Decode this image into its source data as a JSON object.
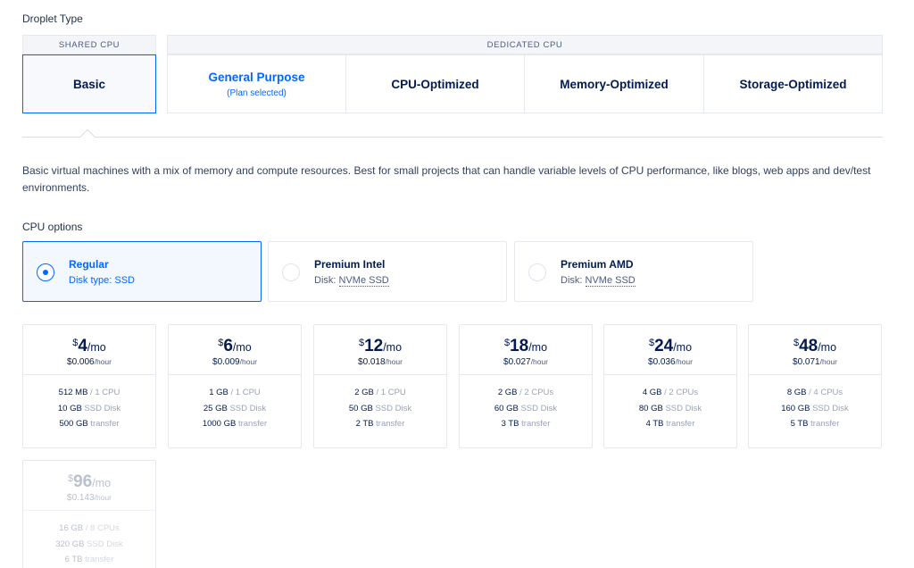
{
  "droplet_type": {
    "title": "Droplet Type",
    "shared_label": "SHARED CPU",
    "dedicated_label": "DEDICATED CPU",
    "plans": {
      "basic": "Basic",
      "general_purpose": "General Purpose",
      "general_purpose_sub": "(Plan selected)",
      "cpu_optimized": "CPU-Optimized",
      "memory_optimized": "Memory-Optimized",
      "storage_optimized": "Storage-Optimized"
    },
    "description": "Basic virtual machines with a mix of memory and compute resources. Best for small projects that can handle variable levels of CPU performance, like blogs, web apps and dev/test environments."
  },
  "cpu_options": {
    "title": "CPU options",
    "regular": {
      "label": "Regular",
      "disk_prefix": "Disk type: ",
      "disk": "SSD"
    },
    "intel": {
      "label": "Premium Intel",
      "disk_prefix": "Disk: ",
      "disk": "NVMe SSD"
    },
    "amd": {
      "label": "Premium AMD",
      "disk_prefix": "Disk: ",
      "disk": "NVMe SSD"
    }
  },
  "pricing": {
    "currency": "$",
    "per_month": "/mo",
    "per_hour": "/hour",
    "cards": [
      {
        "price": "4",
        "hourly": "$0.006",
        "mem": "512 MB",
        "cpu": " / 1 CPU",
        "disk": "10 GB",
        "disk_unit": " SSD Disk",
        "transfer": "500 GB",
        "transfer_unit": " transfer"
      },
      {
        "price": "6",
        "hourly": "$0.009",
        "mem": "1 GB",
        "cpu": " / 1 CPU",
        "disk": "25 GB",
        "disk_unit": " SSD Disk",
        "transfer": "1000 GB",
        "transfer_unit": " transfer"
      },
      {
        "price": "12",
        "hourly": "$0.018",
        "mem": "2 GB",
        "cpu": " / 1 CPU",
        "disk": "50 GB",
        "disk_unit": " SSD Disk",
        "transfer": "2 TB",
        "transfer_unit": " transfer"
      },
      {
        "price": "18",
        "hourly": "$0.027",
        "mem": "2 GB",
        "cpu": " / 2 CPUs",
        "disk": "60 GB",
        "disk_unit": " SSD Disk",
        "transfer": "3 TB",
        "transfer_unit": " transfer"
      },
      {
        "price": "24",
        "hourly": "$0.036",
        "mem": "4 GB",
        "cpu": " / 2 CPUs",
        "disk": "80 GB",
        "disk_unit": " SSD Disk",
        "transfer": "4 TB",
        "transfer_unit": " transfer"
      },
      {
        "price": "48",
        "hourly": "$0.071",
        "mem": "8 GB",
        "cpu": " / 4 CPUs",
        "disk": "160 GB",
        "disk_unit": " SSD Disk",
        "transfer": "5 TB",
        "transfer_unit": " transfer"
      },
      {
        "price": "96",
        "hourly": "$0.143",
        "mem": "16 GB",
        "cpu": " / 8 CPUs",
        "disk": "320 GB",
        "disk_unit": " SSD Disk",
        "transfer": "6 TB",
        "transfer_unit": " transfer"
      }
    ]
  },
  "colors": {
    "accent": "#0069ff",
    "text": "#031b4e",
    "border": "#e5e8ed"
  }
}
